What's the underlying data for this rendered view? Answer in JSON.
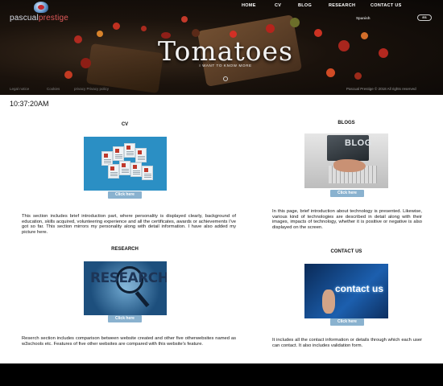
{
  "brand": {
    "name_part1": "pascual",
    "name_part2": "prestige"
  },
  "nav": {
    "items": [
      "HOME",
      "CV",
      "BLOG",
      "RESEARCH",
      "CONTACT US"
    ]
  },
  "header": {
    "language_label": "Spanish",
    "language_button": "ES",
    "hero_title": "Tomatoes",
    "hero_subtitle": "I WANT TO KNOW MORE"
  },
  "footer_links": [
    "Legal notice",
    "Cookies",
    "privacy Privacy policy"
  ],
  "copyright": "Pascual Prestige © 2018 All rights reserved",
  "clock": "10:37:20AM",
  "cards": {
    "cv": {
      "title": "CV",
      "button": "Click here",
      "description": "This section includes brief introduction part, where personality is displayed clearly, background of education, skills acquired, volunteering experience and all the certificates, awards or achievements I've got so far. This section mirrors my personality along with detail information. I have also added my picture here."
    },
    "blogs": {
      "title": "BLOGS",
      "image_text": "BLOG",
      "button": "Click here",
      "description": "In this page, brief introduction about technology is presented. Likewise, various kind of technologies are described in detail along with their images, impacts of technology, whether it is positive or negative is also displayed on the screen."
    },
    "research": {
      "title": "RESEARCH",
      "image_text": "RESEARCH",
      "button": "Click here",
      "description": "Reserch section includes comparison between website created and other five otherwebsites named as w3schools etc. Features of five other websites are compared with this website's feature."
    },
    "contact": {
      "title": "CONTACT US",
      "image_text": "contact us",
      "button": "Click here",
      "description": "It includes all the contact information or details through which each user can contact. It also includes validation form."
    }
  },
  "colors": {
    "button": "#8ab2cf",
    "hero_bg": "#1a120c",
    "title_text": "#f3f3f3"
  }
}
